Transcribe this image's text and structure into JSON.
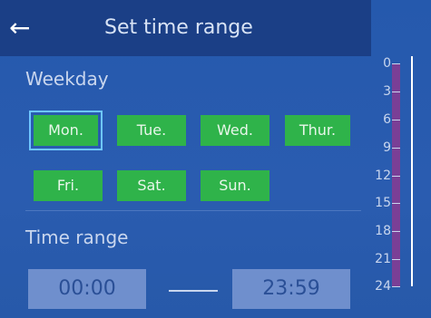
{
  "header": {
    "back_icon": "arrow-left-icon",
    "title": "Set time range"
  },
  "weekday": {
    "label": "Weekday",
    "days": [
      {
        "label": "Mon.",
        "selected": true
      },
      {
        "label": "Tue.",
        "selected": false
      },
      {
        "label": "Wed.",
        "selected": false
      },
      {
        "label": "Thur.",
        "selected": false
      },
      {
        "label": "Fri.",
        "selected": false
      },
      {
        "label": "Sat.",
        "selected": false
      },
      {
        "label": "Sun.",
        "selected": false
      }
    ]
  },
  "time_range": {
    "label": "Time range",
    "start": "00:00",
    "end": "23:59"
  },
  "scale": {
    "ticks": [
      "0",
      "3",
      "6",
      "9",
      "12",
      "15",
      "18",
      "21",
      "24"
    ]
  },
  "colors": {
    "background": "#2559ad",
    "header": "#1b3f86",
    "day_button": "#2fb34a",
    "selected_outline": "#6ec6ff",
    "time_box": "#6f8fcd",
    "range_bar": "#7a3f96"
  }
}
